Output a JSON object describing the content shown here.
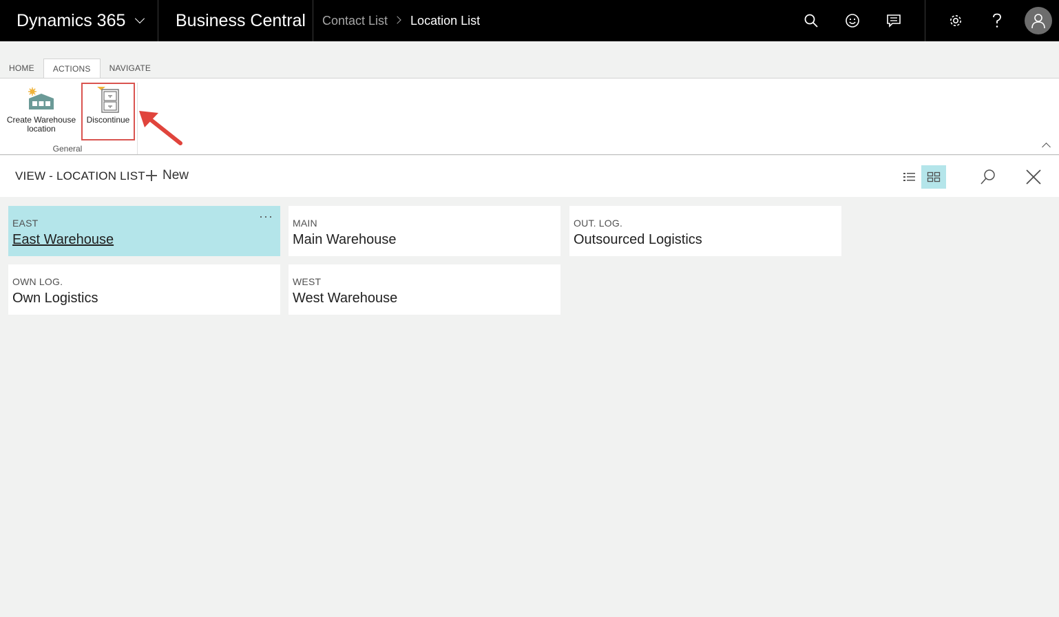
{
  "topbar": {
    "product": "Dynamics 365",
    "app": "Business Central",
    "breadcrumb": [
      "Contact List",
      "Location List"
    ]
  },
  "ribbon": {
    "tabs": [
      {
        "label": "HOME",
        "active": false
      },
      {
        "label": "ACTIONS",
        "active": true
      },
      {
        "label": "NAVIGATE",
        "active": false
      }
    ],
    "actions": {
      "create_warehouse_line1": "Create Warehouse",
      "create_warehouse_line2": "location",
      "discontinue": "Discontinue"
    },
    "group_label": "General"
  },
  "page": {
    "title": "VIEW - LOCATION LIST",
    "new_label": "New"
  },
  "tiles": [
    {
      "code": "EAST",
      "name": "East Warehouse",
      "selected": true
    },
    {
      "code": "MAIN",
      "name": "Main Warehouse",
      "selected": false
    },
    {
      "code": "OUT. LOG.",
      "name": "Outsourced Logistics",
      "selected": false
    },
    {
      "code": "OWN LOG.",
      "name": "Own Logistics",
      "selected": false
    },
    {
      "code": "WEST",
      "name": "West Warehouse",
      "selected": false
    }
  ],
  "tile_more": "···",
  "colors": {
    "topbar_bg": "#000000",
    "selected_tile": "#b4e5ea",
    "highlight_annotation": "#d9534f"
  }
}
